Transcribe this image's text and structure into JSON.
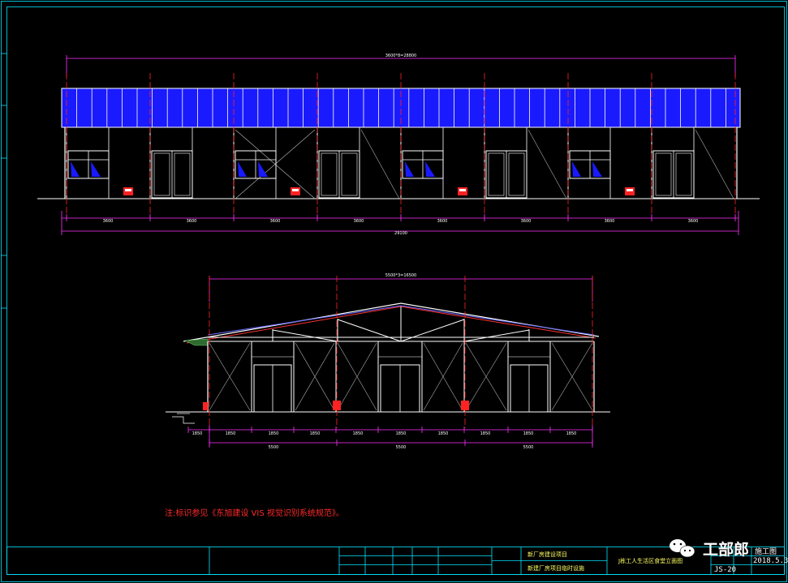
{
  "elevation_top": {
    "overall_dimension": "3600*8=28800",
    "bay_dimensions": [
      "3600",
      "3600",
      "3600",
      "3600",
      "3600",
      "3600",
      "3600",
      "3600"
    ],
    "total_dimension": "29100"
  },
  "elevation_side": {
    "overall_dimension": "5500*3=16500",
    "sub_dimensions": [
      "1850",
      "1850",
      "1850",
      "1850",
      "1850",
      "1850",
      "1850",
      "1850",
      "1850",
      "1850"
    ],
    "group_dimensions": [
      "5500",
      "5500",
      "5500"
    ]
  },
  "note": "注:标识参见《东旭建设 VIS 视觉识别系统规范》。",
  "title_block": {
    "project_name": "新厂房建设项目",
    "drawing_title": "新建厂房项目临时设施",
    "sheet_name": "J栋工人生活区食堂立面图",
    "sheet_type": "施工图",
    "date": "2018.5.3",
    "sheet_number": "JS-20"
  },
  "watermark": {
    "brand": "工部郎",
    "icon": "wechat-icon"
  },
  "colors": {
    "background": "#000000",
    "roof_fill": "#1a1aff",
    "frame": "#ffffff",
    "dim_line": "#ff33ff",
    "axis_red": "#ff2222",
    "border": "#00e5ff",
    "wall_x": "#b0b0b0"
  }
}
